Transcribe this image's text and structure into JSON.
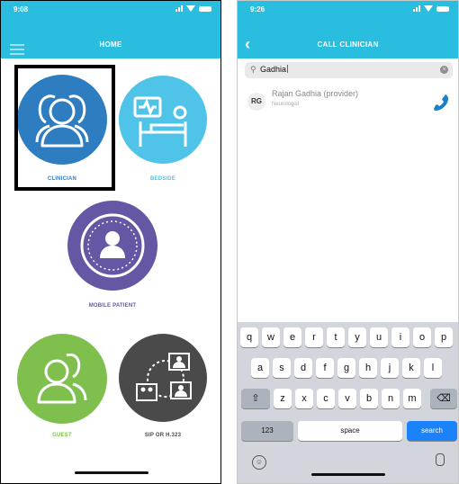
{
  "left_screen": {
    "status_time": "9:08",
    "title": "HOME",
    "tiles": [
      {
        "id": "clinician",
        "label": "CLINICIAN",
        "color": "#2e7dc0"
      },
      {
        "id": "bedside",
        "label": "BEDSIDE",
        "color": "#4fc3e8"
      },
      {
        "id": "mobile_patient",
        "label": "MOBILE PATIENT",
        "color": "#6657a5"
      },
      {
        "id": "guest",
        "label": "GUEST",
        "color": "#7fbf4d"
      },
      {
        "id": "sip",
        "label": "SIP OR H.323",
        "color": "#4a4a4a"
      }
    ],
    "selected_tile": "clinician"
  },
  "right_screen": {
    "status_time": "9:26",
    "title": "CALL CLINICIAN",
    "search_value": "Gadhia",
    "result": {
      "initials": "RG",
      "name": "Rajan Gadhia (provider)",
      "role": "Neurologist"
    },
    "keyboard": {
      "row1": [
        "q",
        "w",
        "e",
        "r",
        "t",
        "y",
        "u",
        "i",
        "o",
        "p"
      ],
      "row2": [
        "a",
        "s",
        "d",
        "f",
        "g",
        "h",
        "j",
        "k",
        "l"
      ],
      "row3": [
        "z",
        "x",
        "c",
        "v",
        "b",
        "n",
        "m"
      ],
      "numbers_key": "123",
      "space_key": "space",
      "search_key": "search"
    }
  },
  "colors": {
    "accent": "#29bde0",
    "call_icon": "#1a82c6",
    "search_key": "#1a82fb"
  }
}
